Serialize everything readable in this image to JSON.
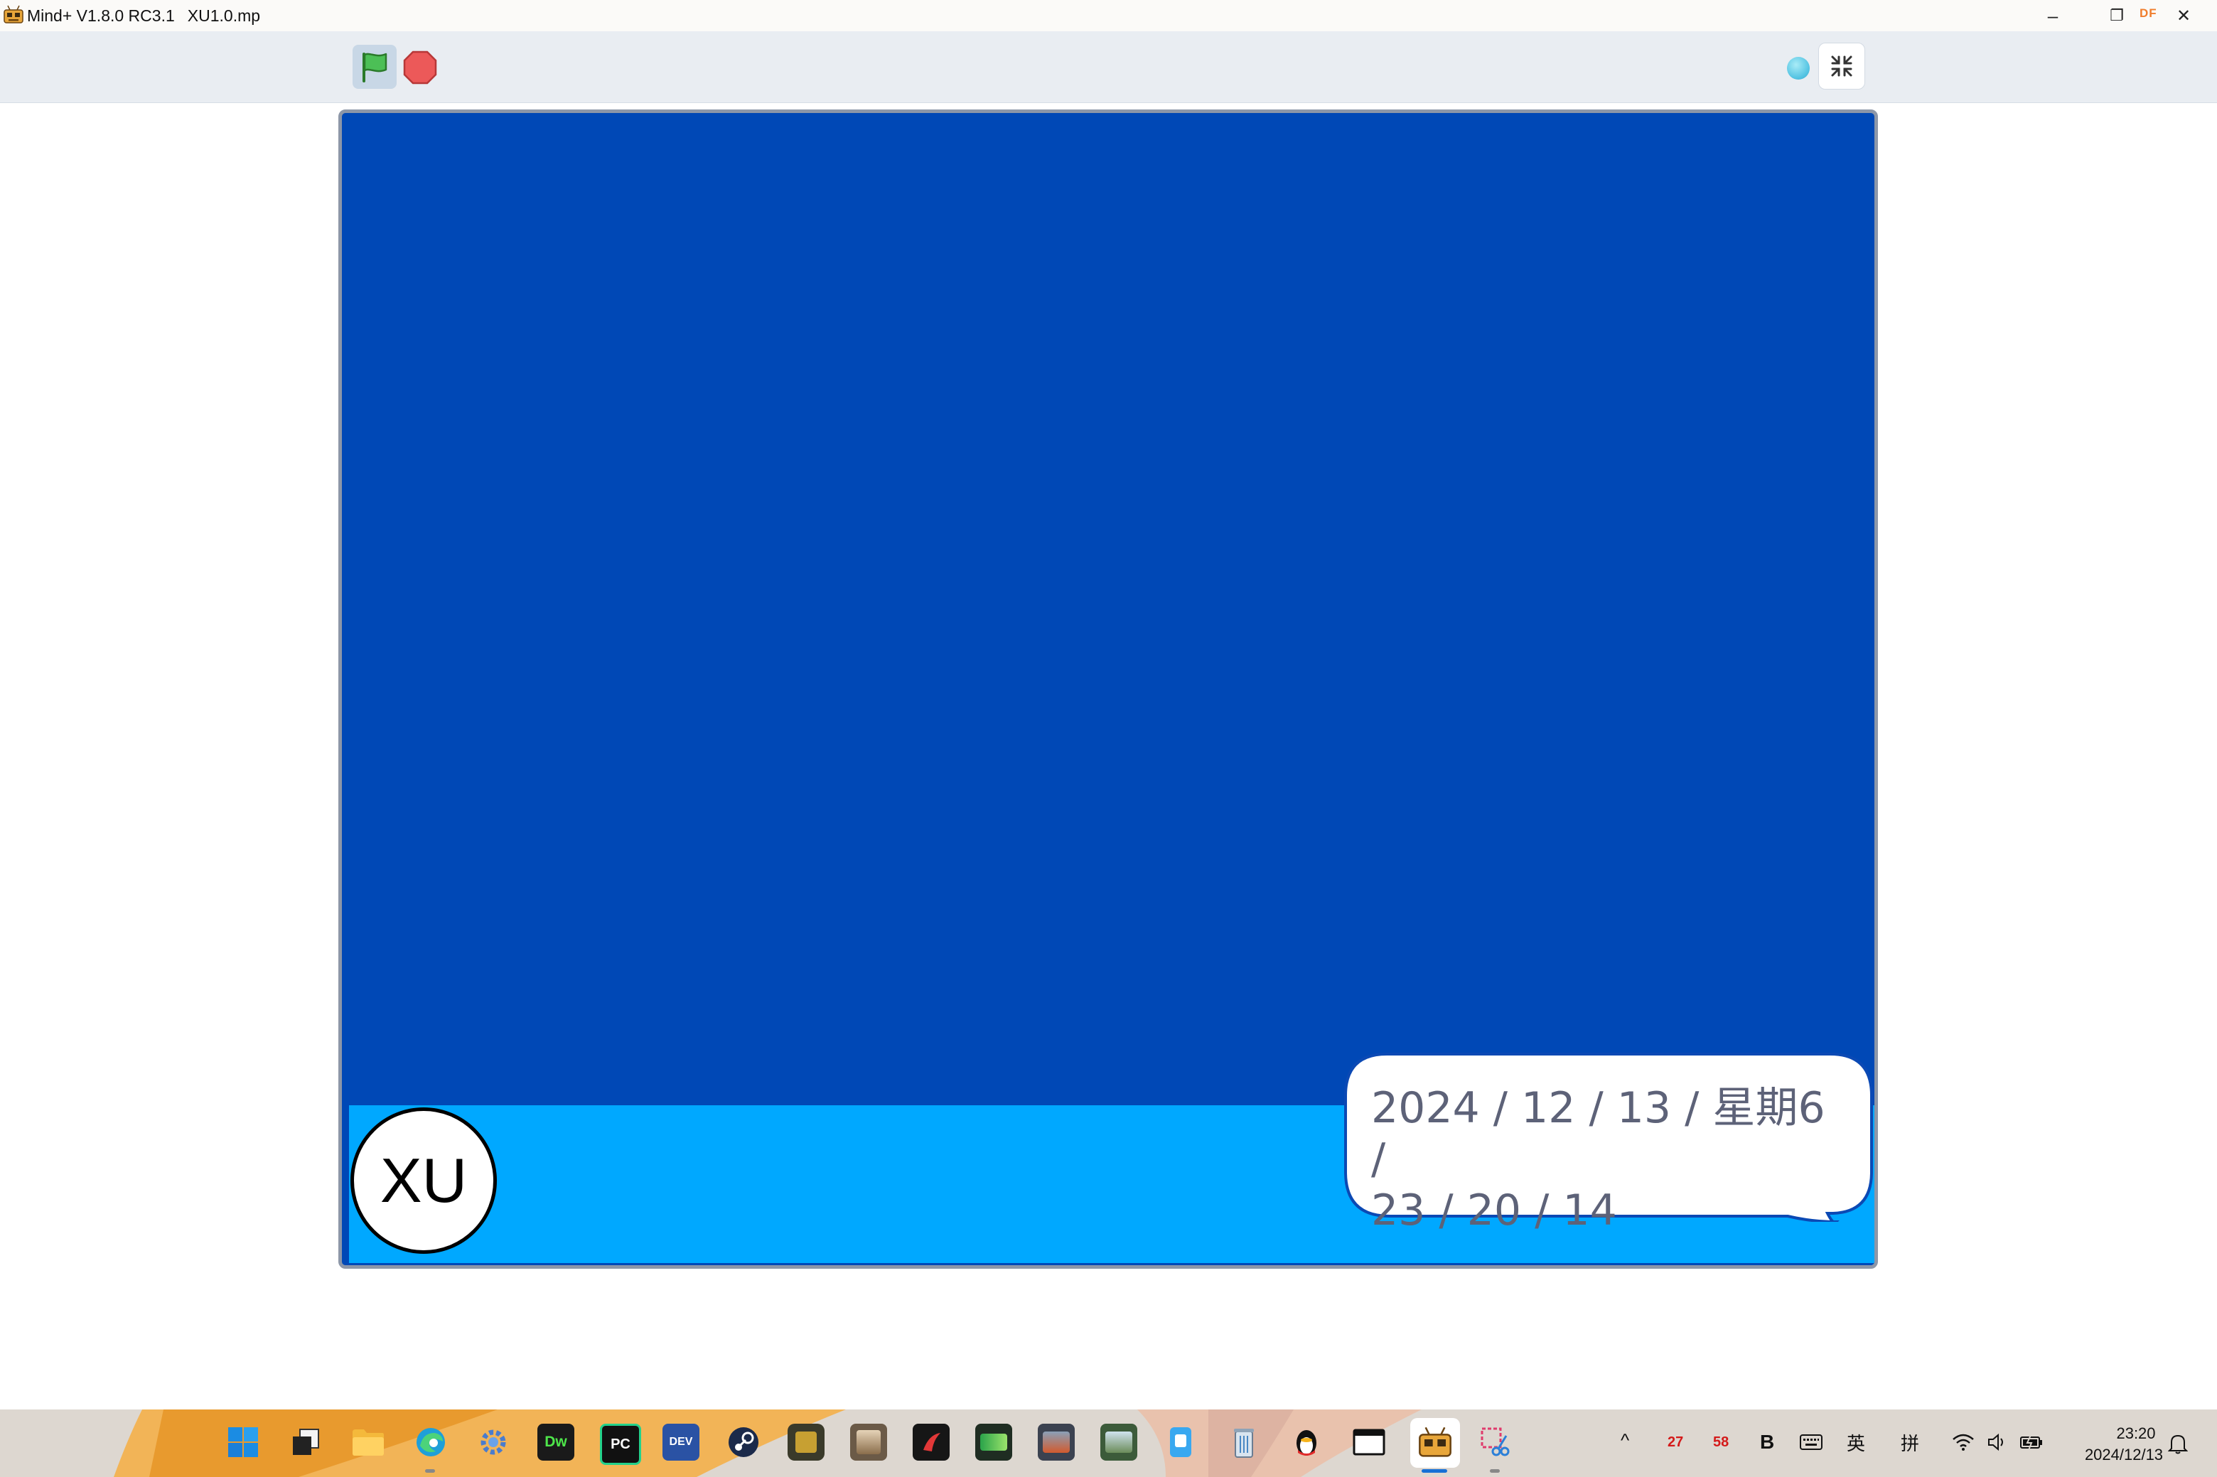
{
  "window": {
    "app_name": "Mind+ V1.8.0 RC3.1",
    "file_name": "XU1.0.mp",
    "badge": "DF",
    "minimize_glyph": "–",
    "restore_glyph": "❐",
    "close_glyph": "✕"
  },
  "toolbar": {
    "green_flag_icon": "flag-icon",
    "stop_icon": "stop-sign-icon",
    "fullscreen_icon": "exit-fullscreen-icon"
  },
  "stage": {
    "sky_color": "#0048b6",
    "ground_color": "#00a8ff",
    "sprite_label": "XU",
    "speech_line1": "2024 / 12 / 13 / 星期6 /",
    "speech_line2": "23 / 20 / 14"
  },
  "taskbar": {
    "pinned": [
      {
        "name": "windows-start",
        "label": ""
      },
      {
        "name": "task-view",
        "label": ""
      },
      {
        "name": "file-explorer",
        "label": ""
      },
      {
        "name": "edge-browser",
        "label": ""
      },
      {
        "name": "settings-gear",
        "label": ""
      },
      {
        "name": "dreamweaver",
        "label": "Dw"
      },
      {
        "name": "pycharm",
        "label": "PC"
      },
      {
        "name": "dev-cpp",
        "label": "DEV"
      },
      {
        "name": "steam",
        "label": ""
      },
      {
        "name": "call-of-duty",
        "label": ""
      },
      {
        "name": "game-characters",
        "label": ""
      },
      {
        "name": "netease-music",
        "label": ""
      },
      {
        "name": "racing-game",
        "label": ""
      },
      {
        "name": "warship-game",
        "label": ""
      },
      {
        "name": "train-sim",
        "label": ""
      },
      {
        "name": "phone-app",
        "label": ""
      },
      {
        "name": "recycle-bin",
        "label": ""
      },
      {
        "name": "qq-penguin",
        "label": ""
      },
      {
        "name": "window-app",
        "label": ""
      },
      {
        "name": "mindplus",
        "label": ""
      },
      {
        "name": "snipping-tool",
        "label": ""
      }
    ],
    "tray": {
      "chevron": "^",
      "temp_cpu": "27",
      "temp_gpu": "58",
      "ime_b": "B",
      "lang_en": "英",
      "lang_pin": "拼",
      "time": "23:20",
      "date": "2024/12/13"
    }
  }
}
